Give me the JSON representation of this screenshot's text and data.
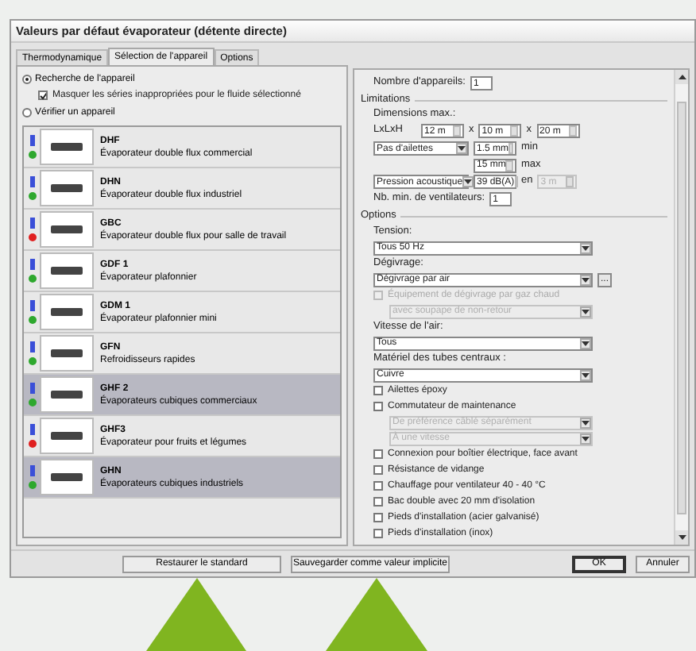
{
  "window": {
    "title": "Valeurs par défaut évaporateur (détente directe)"
  },
  "tabs": [
    {
      "label": "Thermodynamique",
      "selected": false
    },
    {
      "label": "Sélection de l'appareil",
      "selected": true
    },
    {
      "label": "Options",
      "selected": false
    }
  ],
  "mode_options": [
    {
      "label": "Recherche de l'appareil",
      "selected": true
    },
    {
      "label": "Vérifier un appareil",
      "selected": false
    }
  ],
  "hide_unsuitable": {
    "label": "Masquer les séries inappropriées pour le fluide sélectionné",
    "checked": true
  },
  "devices": [
    {
      "name": "DHF",
      "description": "Évaporateur double flux commercial",
      "color": "#2ea82e",
      "selected": false
    },
    {
      "name": "DHN",
      "description": "Évaporateur double flux industriel",
      "color": "#2ea82e",
      "selected": false
    },
    {
      "name": "GBC",
      "description": "Évaporateur double flux pour salle de travail",
      "color": "#e02020",
      "selected": false
    },
    {
      "name": "GDF 1",
      "description": "Évaporateur plafonnier",
      "color": "#2ea82e",
      "selected": false
    },
    {
      "name": "GDM 1",
      "description": "Évaporateur plafonnier mini",
      "color": "#2ea82e",
      "selected": false
    },
    {
      "name": "GFN",
      "description": "Refroidisseurs rapides",
      "color": "#2ea82e",
      "selected": false
    },
    {
      "name": "GHF 2",
      "description": "Évaporateurs cubiques commerciaux",
      "color": "#2ea82e",
      "selected": true
    },
    {
      "name": "GHF3",
      "description": "Évaporateur pour fruits et légumes",
      "color": "#e02020",
      "selected": false
    },
    {
      "name": "GHN",
      "description": "Évaporateurs cubiques industriels",
      "color": "#2ea82e",
      "selected": true
    }
  ],
  "count": {
    "label": "Nombre d'appareils:",
    "value": "1"
  },
  "limitations": {
    "title": "Limitations",
    "max_dimensions_label": "Dimensions max.:",
    "dims_label": "LxLxH",
    "dims": [
      "12 m",
      "10 m",
      "20 m"
    ],
    "dims_separators": [
      "x",
      "x"
    ],
    "fin_select": "Pas d'ailettes",
    "fin_min": "1.5 mm",
    "fin_min_unit": "min",
    "fin_max": "15 mm",
    "fin_max_unit": "max",
    "noise_select": "Pression acoustique",
    "noise_value": "39 dB(A)",
    "noise_unit": "en",
    "noise_distance": "3 m",
    "min_fans_label": "Nb. min. de ventilateurs:",
    "min_fans": "1"
  },
  "options": {
    "title": "Options",
    "rows": [
      {
        "kind": "label",
        "text": "Tension:"
      },
      {
        "kind": "select",
        "value": "Tous 50 Hz",
        "disabled": false
      },
      {
        "kind": "label",
        "text": "Dégivrage:"
      },
      {
        "kind": "select_button",
        "value": "Dégivrage par air",
        "button": "...",
        "disabled": false
      },
      {
        "kind": "checkbox",
        "label": "Équipement de dégivrage par gaz chaud",
        "checked": false,
        "disabled": true
      },
      {
        "kind": "subselect",
        "value": "avec soupape de non-retour",
        "disabled": true
      },
      {
        "kind": "label",
        "text": "Vitesse de l'air:"
      },
      {
        "kind": "select",
        "value": "Tous",
        "disabled": false
      },
      {
        "kind": "label",
        "text": "Matériel des tubes centraux :"
      },
      {
        "kind": "select",
        "value": "Cuivre",
        "disabled": false
      },
      {
        "kind": "checkbox",
        "label": "Ailettes époxy",
        "checked": false,
        "disabled": false
      },
      {
        "kind": "checkbox",
        "label": "Commutateur de maintenance",
        "checked": false,
        "disabled": false
      },
      {
        "kind": "subselect",
        "value": "De préférence câblé séparément",
        "disabled": true
      },
      {
        "kind": "subselect",
        "value": "À une vitesse",
        "disabled": true
      },
      {
        "kind": "checkbox",
        "label": "Connexion pour boîtier électrique, face avant",
        "checked": false,
        "disabled": false
      },
      {
        "kind": "checkbox",
        "label": "Résistance de vidange",
        "checked": false,
        "disabled": false
      },
      {
        "kind": "checkbox",
        "label": "Chauffage pour ventilateur 40 - 40 °C",
        "checked": false,
        "disabled": false
      },
      {
        "kind": "checkbox",
        "label": "Bac double avec 20 mm d'isolation",
        "checked": false,
        "disabled": false
      },
      {
        "kind": "checkbox",
        "label": "Pieds d'installation (acier galvanisé)",
        "checked": false,
        "disabled": false
      },
      {
        "kind": "checkbox",
        "label": "Pieds d'installation (inox)",
        "checked": false,
        "disabled": false
      }
    ]
  },
  "buttons": [
    {
      "label": "Restaurer le standard",
      "kind": "wide",
      "default": false
    },
    {
      "label": "Sauvegarder comme valeur implicite",
      "kind": "wide",
      "default": false
    },
    {
      "label": "OK",
      "kind": "small",
      "default": true
    },
    {
      "label": "Annuler",
      "kind": "small",
      "default": false
    }
  ]
}
